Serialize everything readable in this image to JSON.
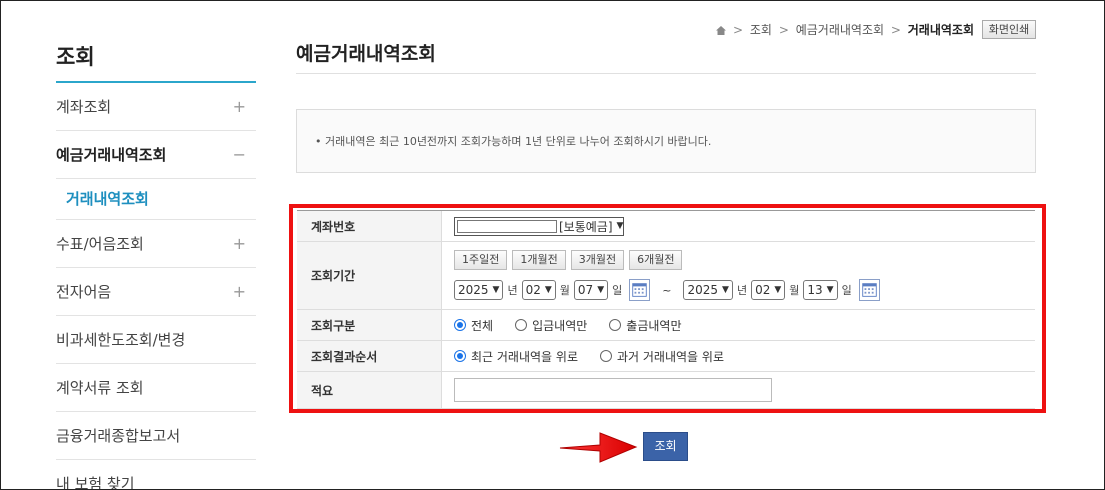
{
  "sidebar": {
    "title": "조회",
    "items": [
      {
        "label": "계좌조회",
        "toggle": "+"
      },
      {
        "label": "예금거래내역조회",
        "toggle": "−"
      },
      {
        "label": "거래내역조회"
      },
      {
        "label": "수표/어음조회",
        "toggle": "+"
      },
      {
        "label": "전자어음",
        "toggle": "+"
      },
      {
        "label": "비과세한도조회/변경"
      },
      {
        "label": "계약서류 조회"
      },
      {
        "label": "금융거래종합보고서"
      },
      {
        "label": "내 보험 찾기"
      }
    ]
  },
  "breadcrumb": {
    "home_icon": "home-icon",
    "items": [
      "조회",
      "예금거래내역조회",
      "거래내역조회"
    ],
    "print_label": "화면인쇄"
  },
  "page": {
    "title": "예금거래내역조회",
    "notice": "• 거래내역은 최근 10년전까지 조회가능하며 1년 단위로 나누어 조회하시기 바랍니다."
  },
  "form": {
    "account": {
      "label": "계좌번호",
      "value": "",
      "type": "[보통예금]"
    },
    "period": {
      "label": "조회기간",
      "buttons": [
        "1주일전",
        "1개월전",
        "3개월전",
        "6개월전"
      ],
      "start": {
        "year": "2025",
        "month": "02",
        "day": "07"
      },
      "end": {
        "year": "2025",
        "month": "02",
        "day": "13"
      },
      "units": {
        "year": "년",
        "month": "월",
        "day": "일"
      },
      "tilde": "~",
      "calendar_icon": "calendar-icon"
    },
    "kind": {
      "label": "조회구분",
      "options": [
        "전체",
        "입금내역만",
        "출금내역만"
      ],
      "selected": "전체"
    },
    "order": {
      "label": "조회결과순서",
      "options": [
        "최근 거래내역을 위로",
        "과거 거래내역을 위로"
      ],
      "selected": "최근 거래내역을 위로"
    },
    "memo": {
      "label": "적요",
      "value": ""
    }
  },
  "submit_label": "조회",
  "colors": {
    "accent": "#2ba6cb",
    "highlight": "#ee1111",
    "button": "#3b63a8"
  }
}
